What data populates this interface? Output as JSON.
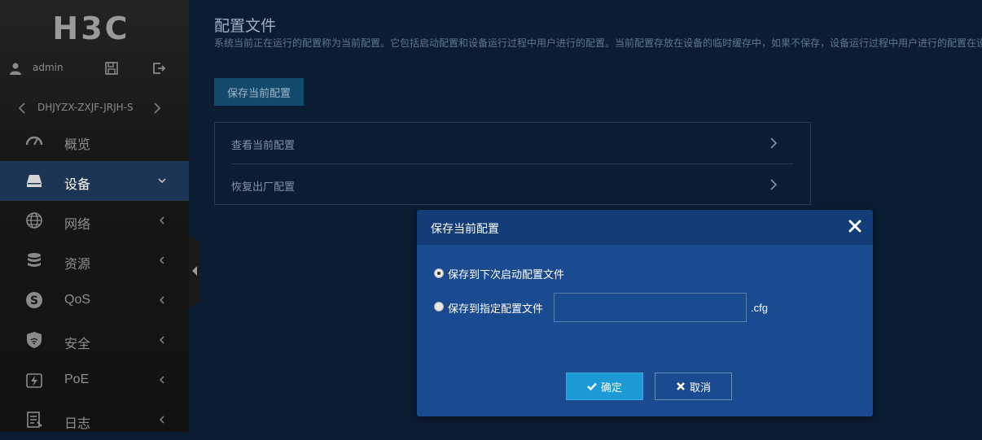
{
  "app": {
    "logo_text": "H3C"
  },
  "user": {
    "name": "admin",
    "icons": [
      "user-icon",
      "save-icon",
      "logout-icon"
    ]
  },
  "device": {
    "name": "DHJYZX-ZXJF-JRJH-S"
  },
  "sidebar": {
    "items": [
      {
        "label": "概览",
        "icon": "dashboard-icon",
        "active": false
      },
      {
        "label": "设备",
        "icon": "device-icon",
        "active": true
      },
      {
        "label": "网络",
        "icon": "globe-icon",
        "active": false
      },
      {
        "label": "资源",
        "icon": "database-icon",
        "active": false
      },
      {
        "label": "QoS",
        "icon": "qos-icon",
        "active": false
      },
      {
        "label": "安全",
        "icon": "shield-icon",
        "active": false
      },
      {
        "label": "PoE",
        "icon": "poe-icon",
        "active": false
      },
      {
        "label": "日志",
        "icon": "log-icon",
        "active": false
      }
    ]
  },
  "page": {
    "title": "配置文件",
    "description": "系统当前正在运行的配置称为当前配置。它包括启动配置和设备运行过程中用户进行的配置。当前配置存放在设备的临时缓存中，如果不保存，设备运行过程中用户进行的配置在设",
    "save_button": "保存当前配置",
    "panel_items": [
      "查看当前配置",
      "恢复出厂配置"
    ]
  },
  "dialog": {
    "title": "保存当前配置",
    "option_next_startup": "保存到下次启动配置文件",
    "option_specified": "保存到指定配置文件",
    "filename_value": "",
    "extension": ".cfg",
    "selected_option": "next_startup",
    "ok_label": "确定",
    "cancel_label": "取消"
  },
  "colors": {
    "accent": "#1b9ad6",
    "dialog_bg": "#1a4b90",
    "dialog_header": "#133d78",
    "sidebar_active": "#1d3554",
    "page_bg": "#0b1d33"
  }
}
